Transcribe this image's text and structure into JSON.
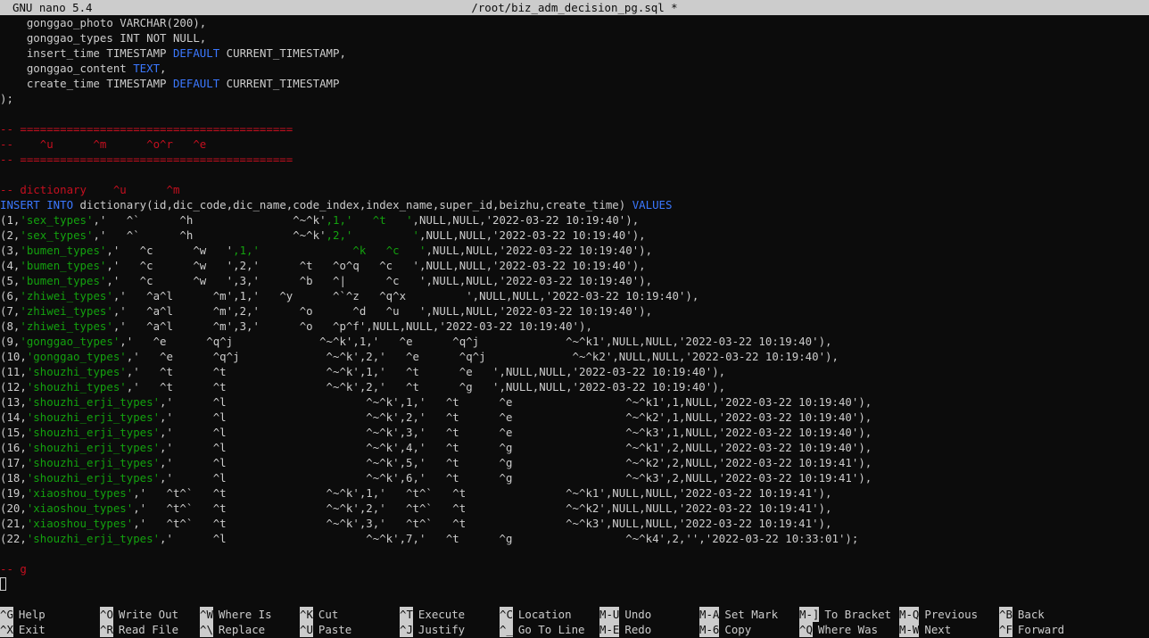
{
  "titlebar": {
    "version": "GNU nano 5.4",
    "filename": "/root/biz_adm_decision_pg.sql *"
  },
  "colors": {
    "background": "#0c0c0c",
    "text": "#cccccc",
    "comment": "#c50f1f",
    "string": "#13a10e",
    "keyword": "#3b78ff"
  },
  "lines": [
    [
      [
        "d",
        "    gonggao_photo VARCHAR(200),"
      ]
    ],
    [
      [
        "d",
        "    gonggao_types INT NOT NULL,"
      ]
    ],
    [
      [
        "d",
        "    insert_time TIMESTAMP "
      ],
      [
        "b",
        "DEFAULT"
      ],
      [
        "d",
        " CURRENT_TIMESTAMP,"
      ]
    ],
    [
      [
        "d",
        "    gonggao_content "
      ],
      [
        "b",
        "TEXT"
      ],
      [
        "d",
        ","
      ]
    ],
    [
      [
        "d",
        "    create_time TIMESTAMP "
      ],
      [
        "b",
        "DEFAULT"
      ],
      [
        "d",
        " CURRENT_TIMESTAMP"
      ]
    ],
    [
      [
        "d",
        ");"
      ]
    ],
    [
      [
        "d",
        ""
      ]
    ],
    [
      [
        "r",
        "-- ========================================="
      ]
    ],
    [
      [
        "r",
        "--    ^u      ^m      ^o^r   ^e"
      ]
    ],
    [
      [
        "r",
        "-- ========================================="
      ]
    ],
    [
      [
        "d",
        ""
      ]
    ],
    [
      [
        "r",
        "-- dictionary    ^u      ^m"
      ]
    ],
    [
      [
        "b",
        "INSERT INTO"
      ],
      [
        "d",
        " dictionary(id,dic_code,dic_name,code_index,index_name,super_id,beizhu,create_time) "
      ],
      [
        "b",
        "VALUES"
      ]
    ],
    [
      [
        "d",
        "(1,"
      ],
      [
        "g",
        "'sex_types'"
      ],
      [
        "d",
        ",'   ^`      ^h               ^~^k'"
      ],
      [
        "g",
        ",1,'   ^t   '"
      ],
      [
        "d",
        ",NULL,NULL,'2022-03-22 10:19:40'),"
      ]
    ],
    [
      [
        "d",
        "(2,"
      ],
      [
        "g",
        "'sex_types'"
      ],
      [
        "d",
        ",'   ^`      ^h               ^~^k'"
      ],
      [
        "g",
        ",2,'         '"
      ],
      [
        "d",
        ",NULL,NULL,'2022-03-22 10:19:40'),"
      ]
    ],
    [
      [
        "d",
        "(3,"
      ],
      [
        "g",
        "'bumen_types'"
      ],
      [
        "d",
        ",'   ^c      ^w   '"
      ],
      [
        "g",
        ",1,'              ^k   ^c   '"
      ],
      [
        "d",
        ",NULL,NULL,'2022-03-22 10:19:40'),"
      ]
    ],
    [
      [
        "d",
        "(4,"
      ],
      [
        "g",
        "'bumen_types'"
      ],
      [
        "d",
        ",'   ^c      ^w   ',2,'      ^t   ^o^q   ^c   '"
      ],
      [
        "d",
        ",NULL,NULL,'2022-03-22 10:19:40'),"
      ]
    ],
    [
      [
        "d",
        "(5,"
      ],
      [
        "g",
        "'bumen_types'"
      ],
      [
        "d",
        ",'   ^c      ^w   ',3,'      ^b   ^|      ^c   '"
      ],
      [
        "d",
        ",NULL,NULL,'2022-03-22 10:19:40'),"
      ]
    ],
    [
      [
        "d",
        "(6,"
      ],
      [
        "g",
        "'zhiwei_types'"
      ],
      [
        "d",
        ",'   ^a^l      ^m',1,'   ^y      ^`^z   ^q^x         '"
      ],
      [
        "d",
        ",NULL,NULL,'2022-03-22 10:19:40'),"
      ]
    ],
    [
      [
        "d",
        "(7,"
      ],
      [
        "g",
        "'zhiwei_types'"
      ],
      [
        "d",
        ",'   ^a^l      ^m',2,'      ^o      ^d   ^u   '"
      ],
      [
        "d",
        ",NULL,NULL,'2022-03-22 10:19:40'),"
      ]
    ],
    [
      [
        "d",
        "(8,"
      ],
      [
        "g",
        "'zhiwei_types'"
      ],
      [
        "d",
        ",'   ^a^l      ^m',3,'      ^o   ^p^f',NULL,NULL,'2022-03-22 10:19:40'),"
      ]
    ],
    [
      [
        "d",
        "(9,"
      ],
      [
        "g",
        "'gonggao_types'"
      ],
      [
        "d",
        ",'   ^e      ^q^j             ^~^k',1,'   ^e      ^q^j             ^~^k1',NULL,NULL,'2022-03-22 10:19:40'),"
      ]
    ],
    [
      [
        "d",
        "(10,"
      ],
      [
        "g",
        "'gonggao_types'"
      ],
      [
        "d",
        ",'   ^e      ^q^j             ^~^k',2,'   ^e      ^q^j             ^~^k2',NULL,NULL,'2022-03-22 10:19:40'),"
      ]
    ],
    [
      [
        "d",
        "(11,"
      ],
      [
        "g",
        "'shouzhi_types'"
      ],
      [
        "d",
        ",'   ^t      ^t               ^~^k',1,'   ^t      ^e   ',NULL,NULL,'2022-03-22 10:19:40'),"
      ]
    ],
    [
      [
        "d",
        "(12,"
      ],
      [
        "g",
        "'shouzhi_types'"
      ],
      [
        "d",
        ",'   ^t      ^t               ^~^k',2,'   ^t      ^g   ',NULL,NULL,'2022-03-22 10:19:40'),"
      ]
    ],
    [
      [
        "d",
        "(13,"
      ],
      [
        "g",
        "'shouzhi_erji_types'"
      ],
      [
        "d",
        ",'      ^l                     ^~^k',1,'   ^t      ^e                 ^~^k1',1,NULL,'2022-03-22 10:19:40'),"
      ]
    ],
    [
      [
        "d",
        "(14,"
      ],
      [
        "g",
        "'shouzhi_erji_types'"
      ],
      [
        "d",
        ",'      ^l                     ^~^k',2,'   ^t      ^e                 ^~^k2',1,NULL,'2022-03-22 10:19:40'),"
      ]
    ],
    [
      [
        "d",
        "(15,"
      ],
      [
        "g",
        "'shouzhi_erji_types'"
      ],
      [
        "d",
        ",'      ^l                     ^~^k',3,'   ^t      ^e                 ^~^k3',1,NULL,'2022-03-22 10:19:40'),"
      ]
    ],
    [
      [
        "d",
        "(16,"
      ],
      [
        "g",
        "'shouzhi_erji_types'"
      ],
      [
        "d",
        ",'      ^l                     ^~^k',4,'   ^t      ^g                 ^~^k1',2,NULL,'2022-03-22 10:19:40'),"
      ]
    ],
    [
      [
        "d",
        "(17,"
      ],
      [
        "g",
        "'shouzhi_erji_types'"
      ],
      [
        "d",
        ",'      ^l                     ^~^k',5,'   ^t      ^g                 ^~^k2',2,NULL,'2022-03-22 10:19:41'),"
      ]
    ],
    [
      [
        "d",
        "(18,"
      ],
      [
        "g",
        "'shouzhi_erji_types'"
      ],
      [
        "d",
        ",'      ^l                     ^~^k',6,'   ^t      ^g                 ^~^k3',2,NULL,'2022-03-22 10:19:41'),"
      ]
    ],
    [
      [
        "d",
        "(19,"
      ],
      [
        "g",
        "'xiaoshou_types'"
      ],
      [
        "d",
        ",'   ^t^`   ^t               ^~^k',1,'   ^t^`   ^t               ^~^k1',NULL,NULL,'2022-03-22 10:19:41'),"
      ]
    ],
    [
      [
        "d",
        "(20,"
      ],
      [
        "g",
        "'xiaoshou_types'"
      ],
      [
        "d",
        ",'   ^t^`   ^t               ^~^k',2,'   ^t^`   ^t               ^~^k2',NULL,NULL,'2022-03-22 10:19:41'),"
      ]
    ],
    [
      [
        "d",
        "(21,"
      ],
      [
        "g",
        "'xiaoshou_types'"
      ],
      [
        "d",
        ",'   ^t^`   ^t               ^~^k',3,'   ^t^`   ^t               ^~^k3',NULL,NULL,'2022-03-22 10:19:41'),"
      ]
    ],
    [
      [
        "d",
        "(22,"
      ],
      [
        "g",
        "'shouzhi_erji_types'"
      ],
      [
        "d",
        ",'      ^l                     ^~^k',7,'   ^t      ^g                 ^~^k4',2,'','2022-03-22 10:33:01');"
      ]
    ],
    [
      [
        "d",
        ""
      ]
    ],
    [
      [
        "r",
        "-- g"
      ]
    ]
  ],
  "shortcuts": [
    {
      "key": "^G",
      "label": "Help",
      "col": 0,
      "row": 0
    },
    {
      "key": "^X",
      "label": "Exit",
      "col": 0,
      "row": 1
    },
    {
      "key": "^O",
      "label": "Write Out",
      "col": 1,
      "row": 0
    },
    {
      "key": "^R",
      "label": "Read File",
      "col": 1,
      "row": 1
    },
    {
      "key": "^W",
      "label": "Where Is",
      "col": 2,
      "row": 0
    },
    {
      "key": "^\\",
      "label": "Replace",
      "col": 2,
      "row": 1
    },
    {
      "key": "^K",
      "label": "Cut",
      "col": 3,
      "row": 0
    },
    {
      "key": "^U",
      "label": "Paste",
      "col": 3,
      "row": 1
    },
    {
      "key": "^T",
      "label": "Execute",
      "col": 4,
      "row": 0
    },
    {
      "key": "^J",
      "label": "Justify",
      "col": 4,
      "row": 1
    },
    {
      "key": "^C",
      "label": "Location",
      "col": 5,
      "row": 0
    },
    {
      "key": "^_",
      "label": "Go To Line",
      "col": 5,
      "row": 1
    },
    {
      "key": "M-U",
      "label": "Undo",
      "col": 6,
      "row": 0
    },
    {
      "key": "M-E",
      "label": "Redo",
      "col": 6,
      "row": 1
    },
    {
      "key": "M-A",
      "label": "Set Mark",
      "col": 7,
      "row": 0
    },
    {
      "key": "M-6",
      "label": "Copy",
      "col": 7,
      "row": 1
    },
    {
      "key": "M-]",
      "label": "To Bracket",
      "col": 8,
      "row": 0
    },
    {
      "key": "^Q",
      "label": "Where Was",
      "col": 8,
      "row": 1
    },
    {
      "key": "M-Q",
      "label": "Previous",
      "col": 9,
      "row": 0
    },
    {
      "key": "M-W",
      "label": "Next",
      "col": 9,
      "row": 1
    },
    {
      "key": "^B",
      "label": "Back",
      "col": 10,
      "row": 0
    },
    {
      "key": "^F",
      "label": "Forward",
      "col": 10,
      "row": 1
    }
  ]
}
